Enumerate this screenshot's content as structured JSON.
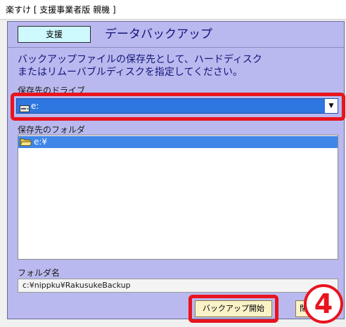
{
  "window": {
    "title": "楽すけ [ 支援事業者版 親機 ]"
  },
  "panel": {
    "badge": "支援",
    "title": "データバックアップ",
    "instructions_line1": "バックアップファイルの保存先として、ハードディスク",
    "instructions_line2": "またはリムーバブルディスクを指定してください。"
  },
  "drive": {
    "label": "保存先のドライブ",
    "value": "e:",
    "icon": "drive-icon"
  },
  "folder": {
    "label": "保存先のフォルダ",
    "items": [
      {
        "label": "e:¥",
        "icon": "open-folder-icon"
      }
    ]
  },
  "folder_name": {
    "label": "フォルダ名",
    "value": "c:¥nippku¥RakusukeBackup"
  },
  "buttons": {
    "backup_start": "バックアップ開始",
    "next_partial": "閉"
  },
  "annotation": {
    "step_number": "4",
    "highlight_color": "#e8141e"
  },
  "colors": {
    "panel_bg": "#b9b9ef",
    "selection": "#2e76e0",
    "badge_bg": "#cffafd",
    "button_bg": "#fbf3c8"
  }
}
